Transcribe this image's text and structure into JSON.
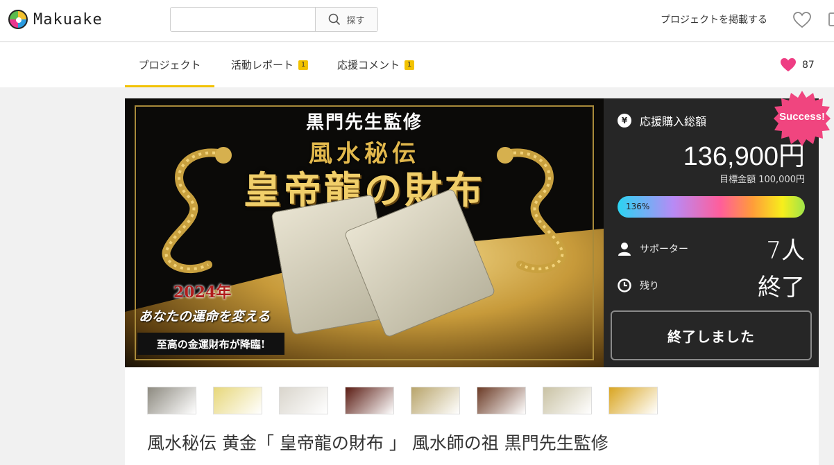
{
  "header": {
    "logo_text": "Makuake",
    "search_placeholder": "",
    "search_button": "探す",
    "post_project_link": "プロジェクトを掲載する"
  },
  "tabs": [
    {
      "label": "プロジェクト",
      "badge": ""
    },
    {
      "label": "活動レポート",
      "badge": "1"
    },
    {
      "label": "応援コメント",
      "badge": "1"
    }
  ],
  "like_count": "87",
  "hero": {
    "line1": "黒門先生監修",
    "line2": "風水秘伝",
    "line3": "皇帝龍の財布",
    "year": "2024年",
    "fate": "あなたの運命を変える",
    "banner": "至高の金運財布が降臨!"
  },
  "panel": {
    "total_label": "応援購入総額",
    "yen_symbol": "¥",
    "total_amount": "136,900円",
    "goal": "目標金額 100,000円",
    "progress_text": "136%",
    "progress": 1.36,
    "supporters_label": "サポーター",
    "supporters_value": "7人",
    "remaining_label": "残り",
    "remaining_value": "終了",
    "ended_button": "終了しました",
    "success_badge": "Success!"
  },
  "thumbnails": [
    {
      "name": "thumb-1",
      "color": "#8d8a80"
    },
    {
      "name": "thumb-2",
      "color": "#e7d77a"
    },
    {
      "name": "thumb-3",
      "color": "#d9d5cc"
    },
    {
      "name": "thumb-4",
      "color": "#5a1b12"
    },
    {
      "name": "thumb-5",
      "color": "#b8a46a"
    },
    {
      "name": "thumb-6",
      "color": "#6b3a25"
    },
    {
      "name": "thumb-7",
      "color": "#c9c2a4"
    },
    {
      "name": "thumb-8",
      "color": "#d9a521"
    }
  ],
  "project_title": "風水秘伝 黄金「 皇帝龍の財布 」 風水師の祖 黒門先生監修",
  "colors": {
    "accent": "#f2c200",
    "heart": "#ee3d83",
    "panel_bg": "#262626"
  }
}
